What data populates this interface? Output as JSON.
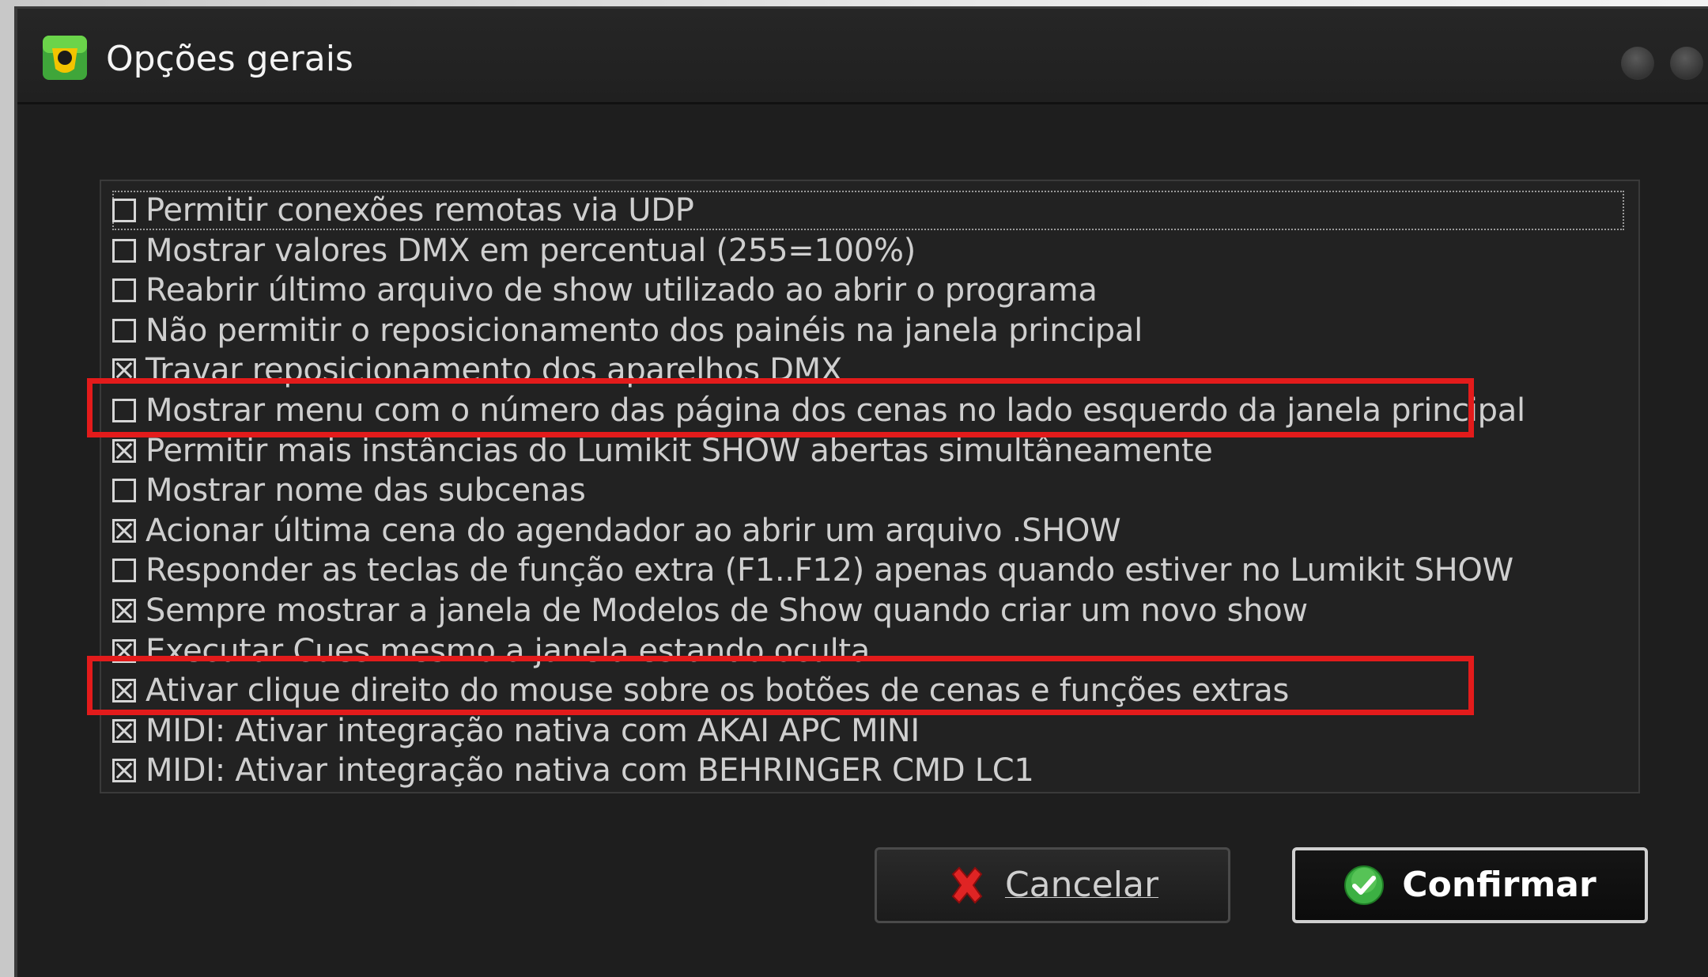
{
  "window": {
    "title": "Opções gerais",
    "icons": {
      "app": "lumikit-app-icon",
      "minimize": "minimize-circle-icon",
      "close": "close-circle-icon"
    }
  },
  "options": [
    {
      "label": "Permitir conexões remotas via UDP",
      "checked": false,
      "focused": true
    },
    {
      "label": "Mostrar valores DMX em percentual (255=100%)",
      "checked": false
    },
    {
      "label": "Reabrir último arquivo de show utilizado ao abrir o programa",
      "checked": false
    },
    {
      "label": "Não permitir o reposicionamento dos painéis na janela principal",
      "checked": false
    },
    {
      "label": "Travar reposicionamento dos aparelhos DMX",
      "checked": true
    },
    {
      "label": "Mostrar menu com o número das página dos cenas no lado esquerdo da janela principal",
      "checked": false,
      "highlighted": true
    },
    {
      "label": "Permitir mais instâncias do Lumikit SHOW abertas simultâneamente",
      "checked": true
    },
    {
      "label": "Mostrar nome das subcenas",
      "checked": false
    },
    {
      "label": "Acionar última cena do agendador ao abrir um arquivo .SHOW",
      "checked": true
    },
    {
      "label": "Responder as teclas de função extra (F1..F12) apenas quando estiver no Lumikit SHOW",
      "checked": false
    },
    {
      "label": "Sempre mostrar a janela de Modelos de Show quando criar um novo show",
      "checked": true
    },
    {
      "label": "Executar Cues mesmo a janela estando oculta",
      "checked": true
    },
    {
      "label": "Ativar clique direito do mouse sobre os botões de cenas e funções extras",
      "checked": true,
      "highlighted": true
    },
    {
      "label": "MIDI: Ativar integração nativa com AKAI APC MINI",
      "checked": true
    },
    {
      "label": "MIDI: Ativar integração nativa com BEHRINGER CMD LC1",
      "checked": true
    }
  ],
  "buttons": {
    "cancel": {
      "label": "Cancelar",
      "icon": "red-x-icon"
    },
    "confirm": {
      "label": "Confirmar",
      "icon": "green-check-icon"
    }
  },
  "colors": {
    "highlight": "#e31b1b",
    "background": "#1e1e1e",
    "text": "#cfcfcf"
  }
}
